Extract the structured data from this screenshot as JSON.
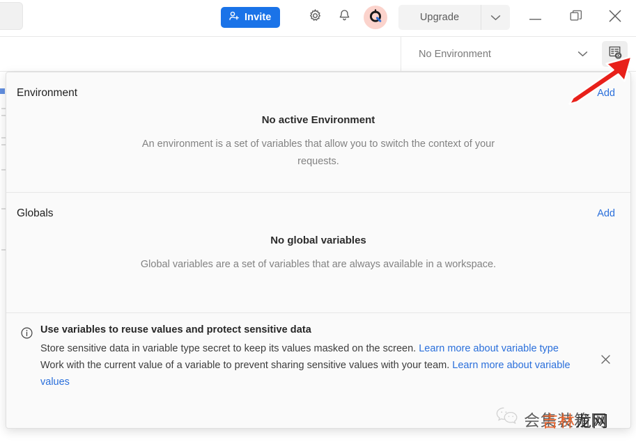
{
  "topbar": {
    "invite_label": "Invite",
    "invite_icon": "person-add-icon",
    "settings_icon": "gear-icon",
    "notifications_icon": "bell-icon",
    "avatar_icon": "user-avatar",
    "upgrade_label": "Upgrade",
    "upgrade_caret_icon": "chevron-down-icon",
    "minimize_icon": "window-minimize-icon",
    "maximize_icon": "window-maximize-icon",
    "close_icon": "window-close-icon"
  },
  "envbar": {
    "selected_environment": "No Environment",
    "caret_icon": "chevron-down-icon",
    "quicklook_icon": "environment-quick-look-icon"
  },
  "popover": {
    "environment": {
      "title": "Environment",
      "add_label": "Add",
      "empty_title": "No active Environment",
      "empty_desc": "An environment is a set of variables that allow you to switch the context of your requests."
    },
    "globals": {
      "title": "Globals",
      "add_label": "Add",
      "empty_title": "No global variables",
      "empty_desc": "Global variables are a set of variables that are always available in a workspace."
    },
    "tip": {
      "info_icon": "info-circle-icon",
      "title": "Use variables to reuse values and protect sensitive data",
      "line1_text": "Store sensitive data in variable type secret to keep its values masked on the screen. ",
      "line1_link": "Learn more about variable type",
      "line2_text": "Work with the current value of a variable to prevent sharing sensitive values with your team. ",
      "line2_link": "Learn more about variable values",
      "close_icon": "close-icon"
    }
  },
  "annotation": {
    "arrow_icon": "red-arrow-pointing-up-right",
    "arrow_color": "#e8201a"
  },
  "watermark": {
    "logo_icon": "wechat-icon",
    "gray_text": "会集装箱网",
    "orange_text": "吉林",
    "dark_text": "龙网"
  },
  "colors": {
    "accent_blue": "#1a73e8",
    "link_blue": "#2a6fdb",
    "panel_bg": "#fafafa",
    "border": "#e0e0e0",
    "avatar_bg": "#fbd3cc"
  }
}
